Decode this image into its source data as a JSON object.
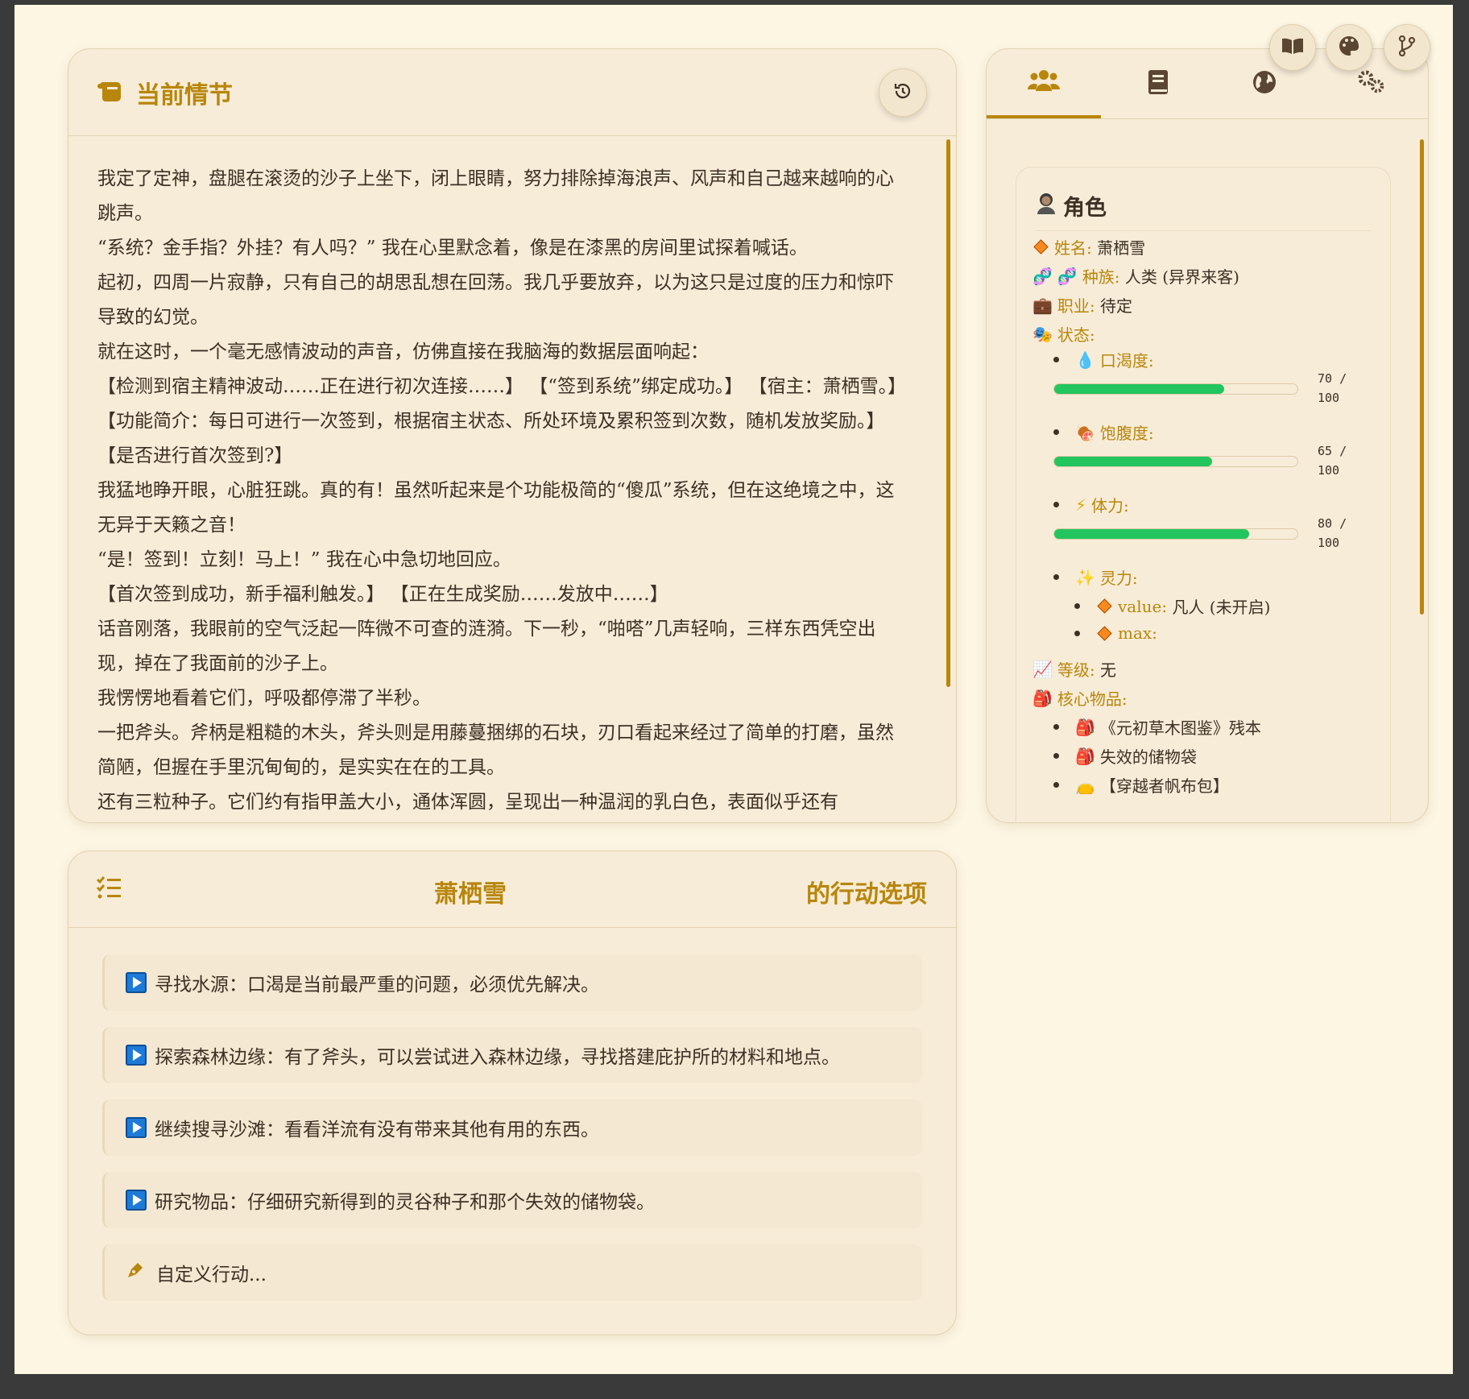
{
  "story": {
    "title": "当前情节",
    "paragraphs": [
      "我定了定神，盘腿在滚烫的沙子上坐下，闭上眼睛，努力排除掉海浪声、风声和自己越来越响的心跳声。",
      "“系统？金手指？外挂？有人吗？” 我在心里默念着，像是在漆黑的房间里试探着喊话。",
      "起初，四周一片寂静，只有自己的胡思乱想在回荡。我几乎要放弃，以为这只是过度的压力和惊吓导致的幻觉。",
      "就在这时，一个毫无感情波动的声音，仿佛直接在我脑海的数据层面响起：",
      "【检测到宿主精神波动……正在进行初次连接……】 【“签到系统”绑定成功。】 【宿主：萧栖雪。】 【功能简介：每日可进行一次签到，根据宿主状态、所处环境及累积签到次数，随机发放奖励。】 【是否进行首次签到?】",
      "我猛地睁开眼，心脏狂跳。真的有！虽然听起来是个功能极简的“傻瓜”系统，但在这绝境之中，这无异于天籁之音！",
      "“是！签到！立刻！马上！” 我在心中急切地回应。",
      "【首次签到成功，新手福利触发。】 【正在生成奖励……发放中……】",
      "话音刚落，我眼前的空气泛起一阵微不可查的涟漪。下一秒，“啪嗒”几声轻响，三样东西凭空出现，掉在了我面前的沙子上。",
      "我愣愣地看着它们，呼吸都停滞了半秒。",
      "一把斧头。斧柄是粗糙的木头，斧头则是用藤蔓捆绑的石块，刃口看起来经过了简单的打磨，虽然简陋，但握在手里沉甸甸的，是实实在在的工具。",
      "还有三粒种子。它们约有指甲盖大小，通体浑圆，呈现出一种温润的乳白色，表面似乎还有"
    ]
  },
  "actions": {
    "character_name": "萧栖雪",
    "title_suffix": "的行动选项",
    "items": [
      "寻找水源：口渴是当前最严重的问题，必须优先解决。",
      "探索森林边缘：有了斧头，可以尝试进入森林边缘，寻找搭建庇护所的材料和地点。",
      "继续搜寻沙滩：看看洋流有没有带来其他有用的东西。",
      "研究物品：仔细研究新得到的灵谷种子和那个失效的储物袋。"
    ],
    "custom_placeholder": "自定义行动..."
  },
  "character": {
    "title": "角色",
    "name_key": "姓名:",
    "name_val": "萧栖雪",
    "race_key": "种族:",
    "race_val": "人类 (异界来客)",
    "job_key": "职业:",
    "job_val": "待定",
    "status_key": "状态:",
    "thirst_key": "口渴度:",
    "thirst_label": "70 / 100",
    "thirst_value": 70,
    "hunger_key": "饱腹度:",
    "hunger_label": "65 / 100",
    "hunger_value": 65,
    "stamina_key": "体力:",
    "stamina_label": "80 / 100",
    "stamina_value": 80,
    "spirit_key": "灵力:",
    "spirit_value_key": "value:",
    "spirit_value_val": "凡人 (未开启)",
    "spirit_max_key": "max:",
    "level_key": "等级:",
    "level_val": "无",
    "items_key": "核心物品:",
    "items": [
      "《元初草木图鉴》残本",
      "失效的储物袋",
      "【穿越者帆布包】"
    ]
  },
  "colors": {
    "accent": "#b8860b",
    "bar": "#22c55e",
    "bg": "#fdf6e3",
    "card": "#f7ecd8"
  }
}
